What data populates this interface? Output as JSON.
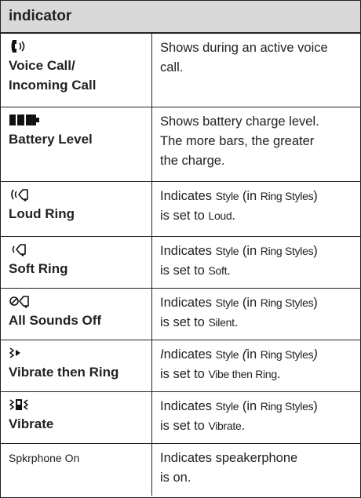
{
  "header": {
    "label": "indicator"
  },
  "rows": [
    {
      "icon": "voice-call-icon",
      "name": "Voice Call/ Incoming Call",
      "name_line1": "Voice Call/",
      "name_line2": "Incoming Call",
      "desc": "Shows during an active voice call.",
      "desc_line1": "Shows during an active voice",
      "desc_line2": "call."
    },
    {
      "icon": "battery-icon",
      "name": "Battery Level",
      "desc_line1": "Shows battery charge level.",
      "desc_line2": "The more bars, the greater",
      "desc_line3": "the charge."
    },
    {
      "icon": "loud-ring-icon",
      "name": "Loud Ring",
      "desc_pre": "Indicates ",
      "desc_style": "Style",
      "desc_mid": " (in ",
      "desc_menu": "Ring Styles",
      "desc_close": ")",
      "desc_set": "is set to ",
      "desc_value": "Loud",
      "desc_end": "."
    },
    {
      "icon": "soft-ring-icon",
      "name": "Soft Ring",
      "desc_pre": "Indicates ",
      "desc_style": "Style",
      "desc_mid": " (in ",
      "desc_menu": "Ring Styles",
      "desc_close": ")",
      "desc_set": "is set to ",
      "desc_value": "Soft",
      "desc_end": "."
    },
    {
      "icon": "all-sounds-off-icon",
      "name": "All Sounds Off",
      "desc_pre": "Indicates ",
      "desc_style": "Style",
      "desc_mid": " (in ",
      "desc_menu": "Ring Styles",
      "desc_close": ")",
      "desc_set": "is set to ",
      "desc_value": "Silent",
      "desc_end": "."
    },
    {
      "icon": "vibrate-then-ring-icon",
      "name": "Vibrate then Ring",
      "desc_pre_i": "I",
      "desc_pre": "ndicates ",
      "desc_style": "Style",
      "desc_mid_i": " (",
      "desc_mid": "in ",
      "desc_menu": "Ring Styles",
      "desc_close": ")",
      "desc_set": "is set to ",
      "desc_value": "Vibe then Ring",
      "desc_end": "."
    },
    {
      "icon": "vibrate-icon",
      "name": "Vibrate",
      "desc_pre": "Indicates ",
      "desc_style": "Style",
      "desc_mid": " (in ",
      "desc_menu": "Ring Styles",
      "desc_close": ")",
      "desc_set": "is set to ",
      "desc_value": "Vibrate",
      "desc_end": "."
    },
    {
      "name": "Spkrphone On",
      "desc_line1": "Indicates speakerphone",
      "desc_line2": "is on."
    }
  ]
}
